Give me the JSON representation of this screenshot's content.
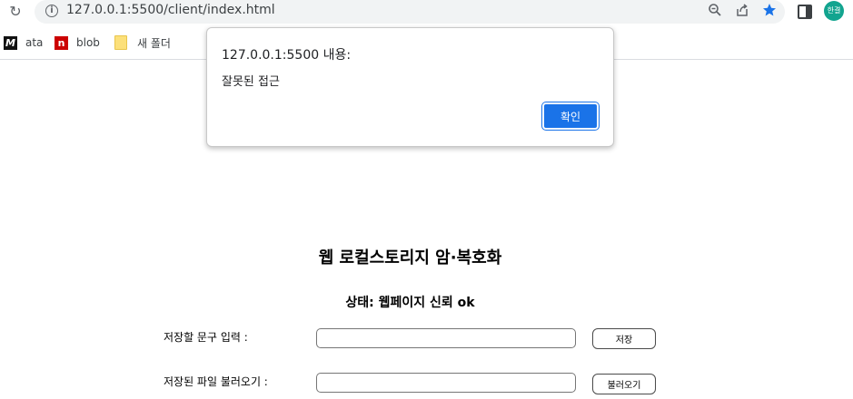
{
  "browser": {
    "url": "127.0.0.1:5500/client/index.html",
    "profile_initials": "한결"
  },
  "bookmarks": [
    {
      "label": "ata",
      "icon": "m-logo-icon"
    },
    {
      "label": "blob",
      "icon": "n-logo-icon"
    },
    {
      "label": "새 폴더",
      "icon": "folder-icon"
    }
  ],
  "dialog": {
    "title": "127.0.0.1:5500 내용:",
    "message": "잘못된 접근",
    "ok_label": "확인"
  },
  "page": {
    "heading": "웹 로컬스토리지 암·복호화",
    "status": "상태: 웹페이지 신뢰 ok",
    "save_label": "저장할 문구 입력 :",
    "save_input_value": "",
    "save_button": "저장",
    "load_label": "저장된 파일 불러오기 :",
    "load_input_value": "",
    "load_button": "불러오기"
  },
  "colors": {
    "accent": "#1a73e8",
    "bookmark_star": "#1a73e8",
    "avatar": "#12a48f"
  }
}
